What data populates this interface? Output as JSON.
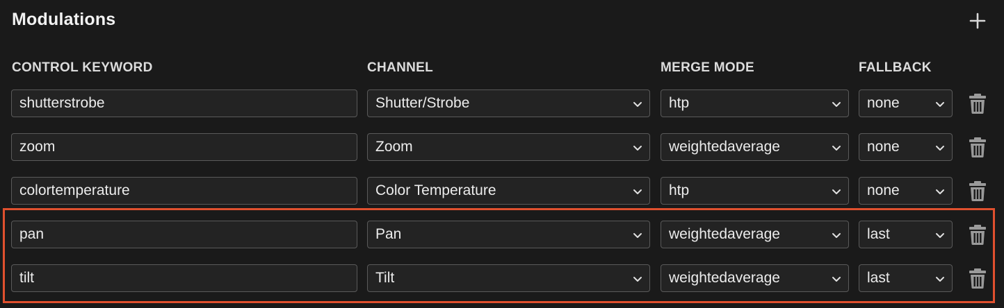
{
  "section": {
    "title": "Modulations"
  },
  "columns": {
    "keyword": "CONTROL KEYWORD",
    "channel": "CHANNEL",
    "merge_mode": "MERGE MODE",
    "fallback": "FALLBACK"
  },
  "rows": [
    {
      "keyword": "shutterstrobe",
      "channel": "Shutter/Strobe",
      "merge_mode": "htp",
      "fallback": "none"
    },
    {
      "keyword": "zoom",
      "channel": "Zoom",
      "merge_mode": "weightedaverage",
      "fallback": "none"
    },
    {
      "keyword": "colortemperature",
      "channel": "Color Temperature",
      "merge_mode": "htp",
      "fallback": "none"
    },
    {
      "keyword": "pan",
      "channel": "Pan",
      "merge_mode": "weightedaverage",
      "fallback": "last"
    },
    {
      "keyword": "tilt",
      "channel": "Tilt",
      "merge_mode": "weightedaverage",
      "fallback": "last"
    }
  ],
  "icons": {
    "add": "plus-icon",
    "delete": "trash-icon",
    "dropdown": "chevron-down-icon"
  },
  "colors": {
    "background": "#1a1a1a",
    "field_background": "#232323",
    "field_border": "#5a5a5a",
    "highlight": "#e0502e"
  }
}
